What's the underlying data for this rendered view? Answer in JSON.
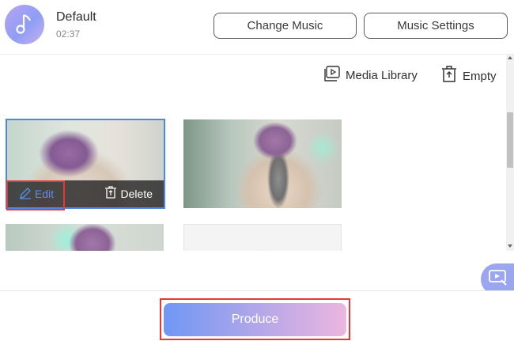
{
  "music": {
    "title": "Default",
    "duration": "02:37",
    "change_label": "Change Music",
    "settings_label": "Music Settings"
  },
  "toolbar": {
    "library_label": "Media Library",
    "empty_label": "Empty"
  },
  "clips": {
    "edit_label": "Edit",
    "delete_label": "Delete"
  },
  "footer": {
    "produce_label": "Produce"
  },
  "colors": {
    "accent": "#4f86e6",
    "highlight_box": "#e53935"
  }
}
